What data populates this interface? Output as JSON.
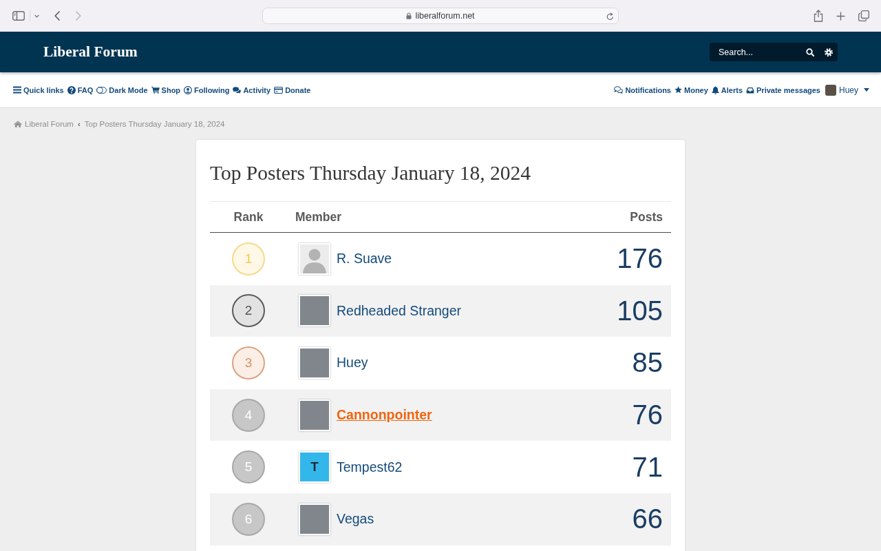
{
  "browser": {
    "url": "liberalforum.net",
    "forward_disabled": true
  },
  "header": {
    "site_title": "Liberal Forum",
    "search": {
      "placeholder": "Search..."
    }
  },
  "nav": {
    "left": [
      {
        "label": "Quick links"
      },
      {
        "label": "FAQ"
      },
      {
        "label": "Dark Mode"
      },
      {
        "label": "Shop"
      },
      {
        "label": "Following"
      },
      {
        "label": "Activity"
      },
      {
        "label": "Donate"
      }
    ],
    "right": [
      {
        "label": "Notifications"
      },
      {
        "label": "Money"
      },
      {
        "label": "Alerts"
      },
      {
        "label": "Private messages"
      }
    ],
    "user": {
      "name": "Huey"
    }
  },
  "breadcrumb": {
    "items": [
      "Liberal Forum",
      "Top Posters Thursday January 18, 2024"
    ],
    "separator": "‹"
  },
  "title": "Top Posters Thursday January 18, 2024",
  "table": {
    "columns": [
      "Rank",
      "Member",
      "Posts"
    ],
    "rows": [
      {
        "rank": "1",
        "kind": "gold",
        "avatar": {
          "kind": "default"
        },
        "member": "R. Suave",
        "highlighted": false,
        "posts": "176"
      },
      {
        "rank": "2",
        "kind": "silver",
        "avatar": {
          "kind": "photo"
        },
        "member": "Redheaded Stranger",
        "highlighted": false,
        "posts": "105"
      },
      {
        "rank": "3",
        "kind": "bronze",
        "avatar": {
          "kind": "photo"
        },
        "member": "Huey",
        "highlighted": false,
        "posts": "85"
      },
      {
        "rank": "4",
        "kind": "plain",
        "avatar": {
          "kind": "photo"
        },
        "member": "Cannonpointer",
        "highlighted": true,
        "posts": "76"
      },
      {
        "rank": "5",
        "kind": "plain",
        "avatar": {
          "kind": "letter",
          "letter": "T",
          "color": "#33b7ea"
        },
        "member": "Tempest62",
        "highlighted": false,
        "posts": "71"
      },
      {
        "rank": "6",
        "kind": "plain",
        "avatar": {
          "kind": "photo"
        },
        "member": "Vegas",
        "highlighted": false,
        "posts": "66"
      }
    ]
  }
}
